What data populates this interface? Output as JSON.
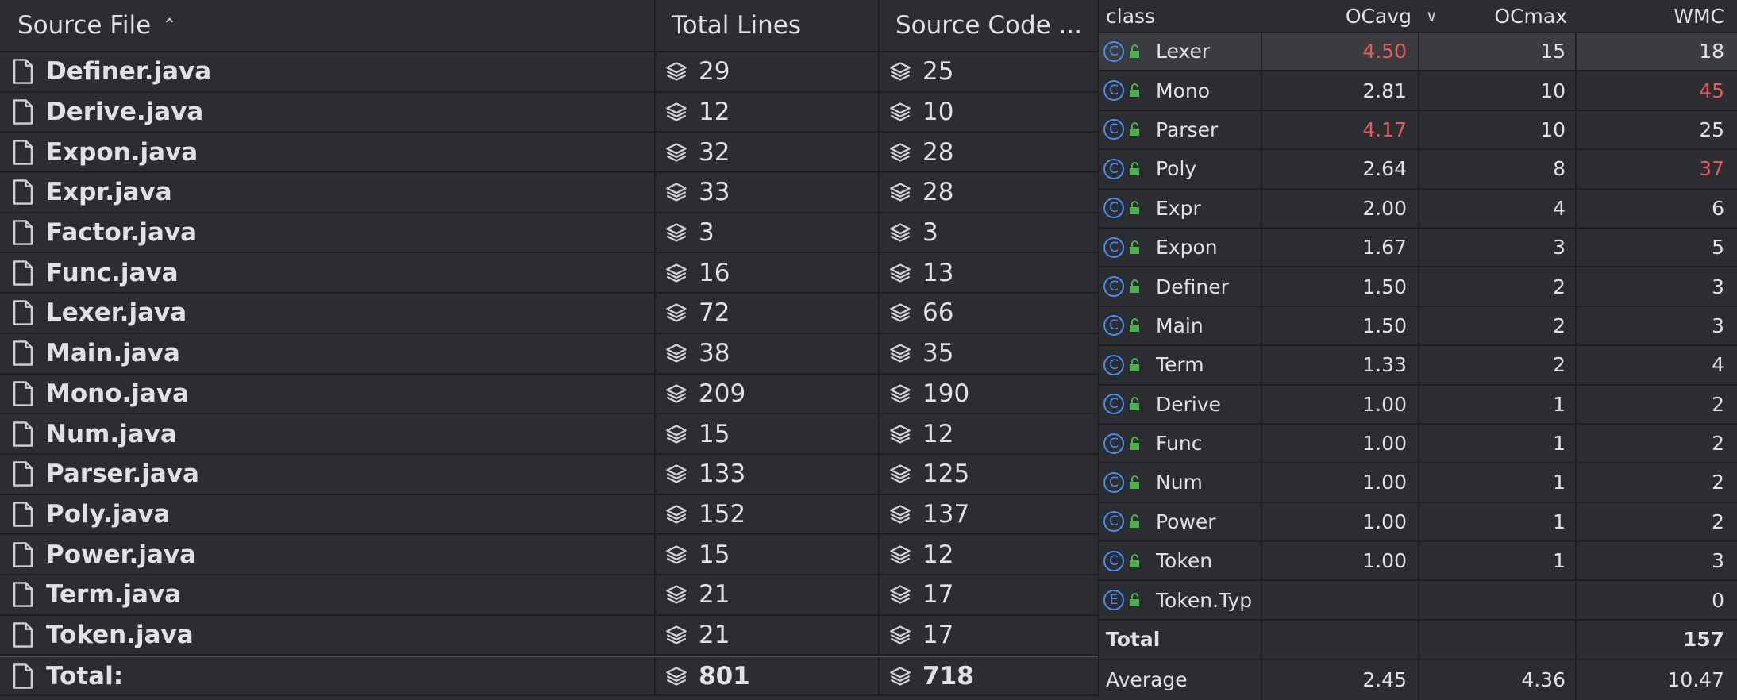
{
  "files_panel": {
    "headers": {
      "file": "Source File",
      "total_lines": "Total Lines",
      "source_code": "Source Code ..."
    },
    "rows": [
      {
        "file": "Definer.java",
        "total": "29",
        "src": "25"
      },
      {
        "file": "Derive.java",
        "total": "12",
        "src": "10"
      },
      {
        "file": "Expon.java",
        "total": "32",
        "src": "28"
      },
      {
        "file": "Expr.java",
        "total": "33",
        "src": "28"
      },
      {
        "file": "Factor.java",
        "total": "3",
        "src": "3"
      },
      {
        "file": "Func.java",
        "total": "16",
        "src": "13"
      },
      {
        "file": "Lexer.java",
        "total": "72",
        "src": "66"
      },
      {
        "file": "Main.java",
        "total": "38",
        "src": "35"
      },
      {
        "file": "Mono.java",
        "total": "209",
        "src": "190"
      },
      {
        "file": "Num.java",
        "total": "15",
        "src": "12"
      },
      {
        "file": "Parser.java",
        "total": "133",
        "src": "125"
      },
      {
        "file": "Poly.java",
        "total": "152",
        "src": "137"
      },
      {
        "file": "Power.java",
        "total": "15",
        "src": "12"
      },
      {
        "file": "Term.java",
        "total": "21",
        "src": "17"
      },
      {
        "file": "Token.java",
        "total": "21",
        "src": "17"
      }
    ],
    "total_row": {
      "file": "Total:",
      "total": "801",
      "src": "718"
    }
  },
  "metrics_panel": {
    "headers": {
      "class": "class",
      "ocavg": "OCavg",
      "ocmax": "OCmax",
      "wmc": "WMC"
    },
    "rows": [
      {
        "kind": "C",
        "name": "Lexer",
        "ocavg": "4.50",
        "ocmax": "15",
        "wmc": "18",
        "ocavg_red": true,
        "wmc_red": false
      },
      {
        "kind": "C",
        "name": "Mono",
        "ocavg": "2.81",
        "ocmax": "10",
        "wmc": "45",
        "ocavg_red": false,
        "wmc_red": true
      },
      {
        "kind": "C",
        "name": "Parser",
        "ocavg": "4.17",
        "ocmax": "10",
        "wmc": "25",
        "ocavg_red": true,
        "wmc_red": false
      },
      {
        "kind": "C",
        "name": "Poly",
        "ocavg": "2.64",
        "ocmax": "8",
        "wmc": "37",
        "ocavg_red": false,
        "wmc_red": true
      },
      {
        "kind": "C",
        "name": "Expr",
        "ocavg": "2.00",
        "ocmax": "4",
        "wmc": "6",
        "ocavg_red": false,
        "wmc_red": false
      },
      {
        "kind": "C",
        "name": "Expon",
        "ocavg": "1.67",
        "ocmax": "3",
        "wmc": "5",
        "ocavg_red": false,
        "wmc_red": false
      },
      {
        "kind": "C",
        "name": "Definer",
        "ocavg": "1.50",
        "ocmax": "2",
        "wmc": "3",
        "ocavg_red": false,
        "wmc_red": false
      },
      {
        "kind": "C",
        "name": "Main",
        "ocavg": "1.50",
        "ocmax": "2",
        "wmc": "3",
        "ocavg_red": false,
        "wmc_red": false
      },
      {
        "kind": "C",
        "name": "Term",
        "ocavg": "1.33",
        "ocmax": "2",
        "wmc": "4",
        "ocavg_red": false,
        "wmc_red": false
      },
      {
        "kind": "C",
        "name": "Derive",
        "ocavg": "1.00",
        "ocmax": "1",
        "wmc": "2",
        "ocavg_red": false,
        "wmc_red": false
      },
      {
        "kind": "C",
        "name": "Func",
        "ocavg": "1.00",
        "ocmax": "1",
        "wmc": "2",
        "ocavg_red": false,
        "wmc_red": false
      },
      {
        "kind": "C",
        "name": "Num",
        "ocavg": "1.00",
        "ocmax": "1",
        "wmc": "2",
        "ocavg_red": false,
        "wmc_red": false
      },
      {
        "kind": "C",
        "name": "Power",
        "ocavg": "1.00",
        "ocmax": "1",
        "wmc": "2",
        "ocavg_red": false,
        "wmc_red": false
      },
      {
        "kind": "C",
        "name": "Token",
        "ocavg": "1.00",
        "ocmax": "1",
        "wmc": "3",
        "ocavg_red": false,
        "wmc_red": false
      },
      {
        "kind": "E",
        "name": "Token.Typ",
        "ocavg": "",
        "ocmax": "",
        "wmc": "0",
        "ocavg_red": false,
        "wmc_red": false
      }
    ],
    "total_row": {
      "label": "Total",
      "ocavg": "",
      "ocmax": "",
      "wmc": "157"
    },
    "average_row": {
      "label": "Average",
      "ocavg": "2.45",
      "ocmax": "4.36",
      "wmc": "10.47"
    }
  },
  "colors": {
    "background": "#2b2d30",
    "warning_red": "#e55a5a",
    "class_badge": "#4b8cf0",
    "lock_green": "#4caf50"
  },
  "icons": {
    "file": "file-icon",
    "layers": "layers-icon",
    "class_badge": "class-icon",
    "enum_badge": "enum-icon",
    "lock": "lock-open-icon",
    "sort_up": "sort-ascending-icon",
    "sort_down": "sort-descending-icon"
  }
}
